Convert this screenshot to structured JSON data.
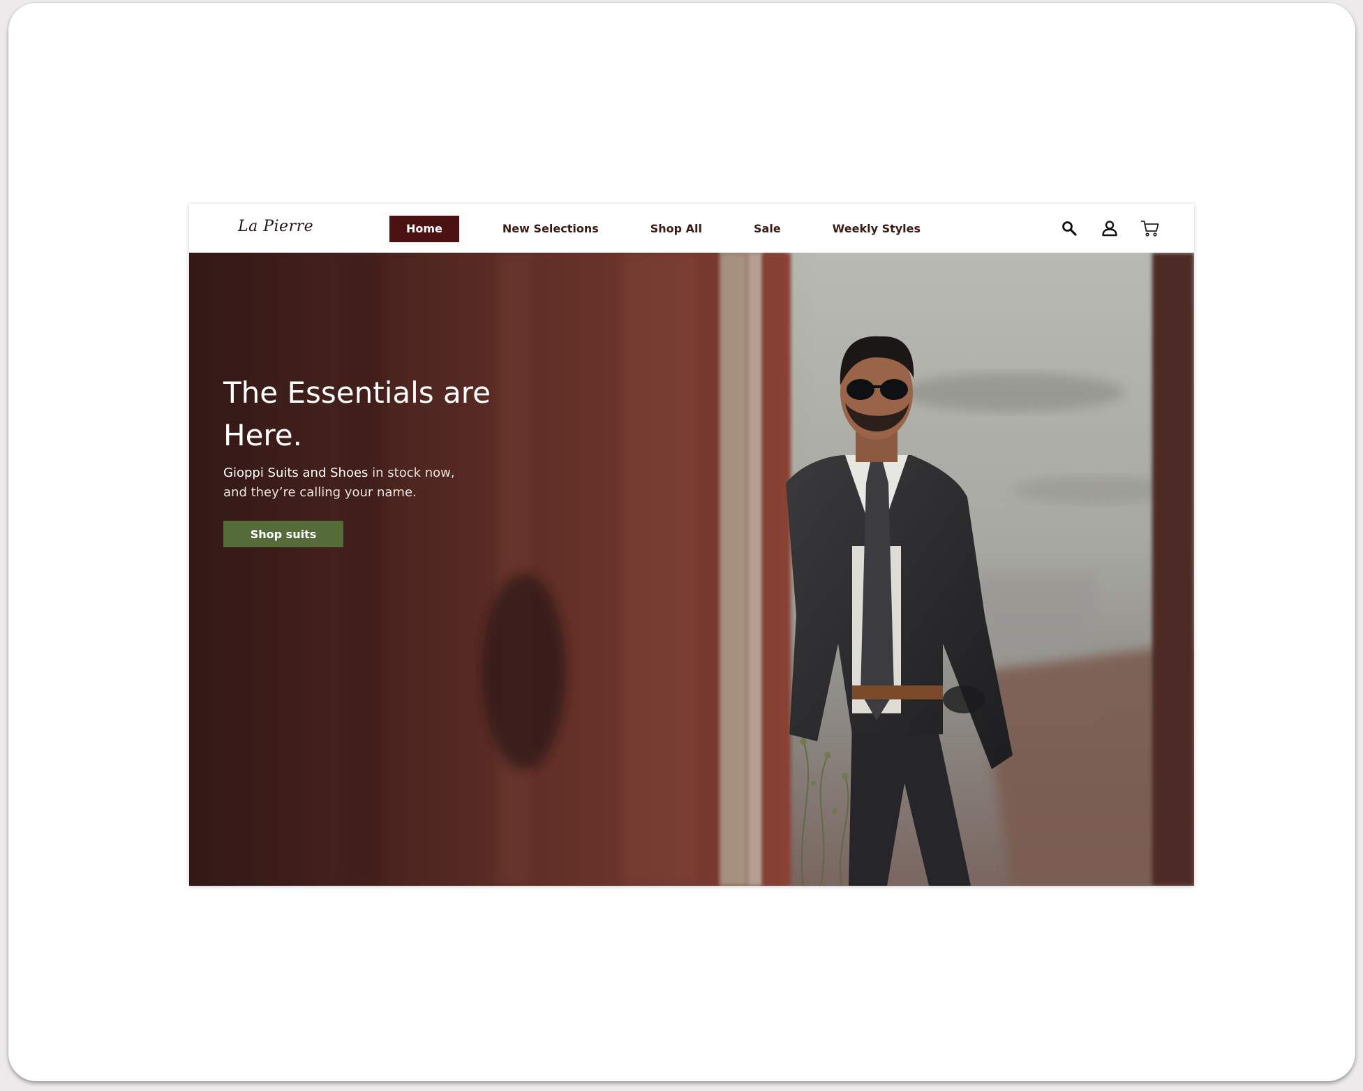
{
  "brand": {
    "logo": "La Pierre"
  },
  "nav": {
    "items": [
      {
        "label": "Home",
        "active": true
      },
      {
        "label": "New Selections",
        "active": false
      },
      {
        "label": "Shop All",
        "active": false
      },
      {
        "label": "Sale",
        "active": false
      },
      {
        "label": "Weekly Styles",
        "active": false
      }
    ]
  },
  "header_icons": [
    "search-icon",
    "user-icon",
    "cart-icon"
  ],
  "hero": {
    "title": "The Essentials are Here.",
    "subtitle_emphasis": "Gioppi Suits and Shoes",
    "subtitle_rest": " in stock now, and they’re calling your name.",
    "cta_label": "Shop suits"
  },
  "colors": {
    "nav_active_bg": "#4a1212",
    "cta_bg": "#566b3a",
    "hero_overlay": "#4a1f1a"
  }
}
